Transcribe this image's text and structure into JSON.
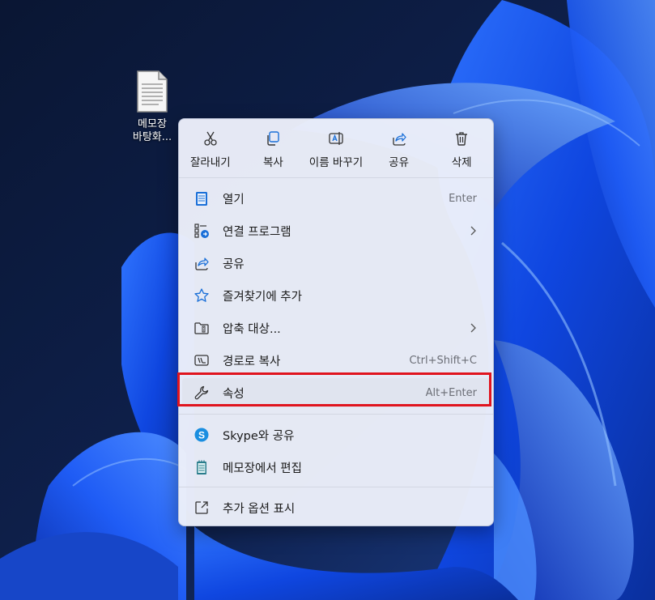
{
  "desktop": {
    "icon_label_line1": "메모장",
    "icon_label_line2": "바탕화..."
  },
  "toolbar": {
    "items": [
      {
        "label": "잘라내기",
        "icon": "cut-icon"
      },
      {
        "label": "복사",
        "icon": "copy-icon"
      },
      {
        "label": "이름 바꾸기",
        "icon": "rename-icon"
      },
      {
        "label": "공유",
        "icon": "share-icon"
      },
      {
        "label": "삭제",
        "icon": "delete-icon"
      }
    ]
  },
  "menu": {
    "items": [
      {
        "label": "열기",
        "shortcut": "Enter",
        "icon": "notepad-icon"
      },
      {
        "label": "연결 프로그램",
        "shortcut": "",
        "icon": "open-with-icon",
        "submenu": true
      },
      {
        "label": "공유",
        "shortcut": "",
        "icon": "share-icon"
      },
      {
        "label": "즐겨찾기에 추가",
        "shortcut": "",
        "icon": "star-icon"
      },
      {
        "label": "압축 대상...",
        "shortcut": "",
        "icon": "compress-icon",
        "submenu": true
      },
      {
        "label": "경로로 복사",
        "shortcut": "Ctrl+Shift+C",
        "icon": "copy-path-icon"
      },
      {
        "label": "속성",
        "shortcut": "Alt+Enter",
        "icon": "wrench-icon",
        "highlighted": true
      },
      {
        "label": "Skype와 공유",
        "shortcut": "",
        "icon": "skype-icon"
      },
      {
        "label": "메모장에서 편집",
        "shortcut": "",
        "icon": "notepad-icon"
      },
      {
        "label": "추가 옵션 표시",
        "shortcut": "",
        "icon": "more-options-icon"
      }
    ]
  },
  "colors": {
    "highlight_border": "#e0141e",
    "menu_background": "#eceffa",
    "accent_blue": "#1a6fd8"
  }
}
